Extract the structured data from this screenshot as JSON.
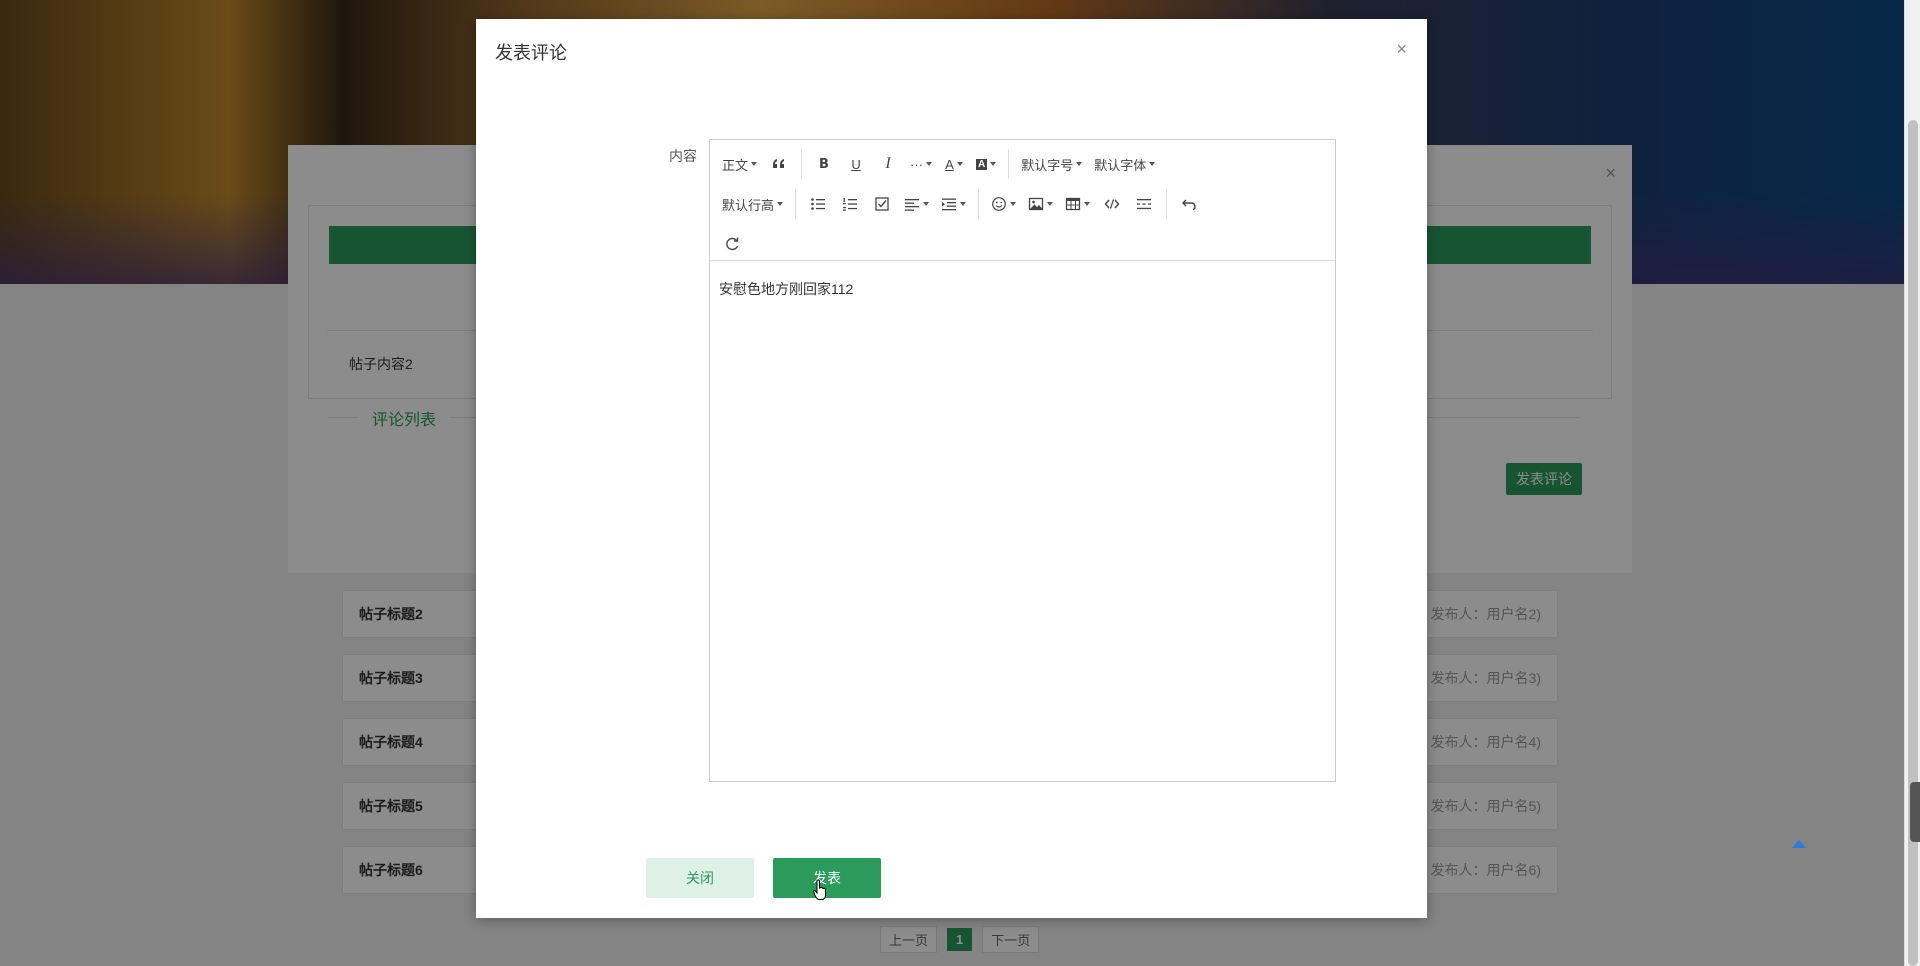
{
  "background": {
    "post_content": "帖子内容2",
    "comment_list_label": "评论列表",
    "post_comment_button": "发表评论",
    "posts": [
      {
        "title": "帖子标题2",
        "author": "发布人：用户名2)"
      },
      {
        "title": "帖子标题3",
        "author": "发布人：用户名3)"
      },
      {
        "title": "帖子标题4",
        "author": "发布人：用户名4)"
      },
      {
        "title": "帖子标题5",
        "author": "发布人：用户名5)"
      },
      {
        "title": "帖子标题6",
        "author": "发布人：用户名6)"
      }
    ],
    "pager": {
      "prev": "上一页",
      "current": "1",
      "next": "下一页"
    }
  },
  "dialog": {
    "title": "发表评论",
    "close_symbol": "×",
    "content_label": "内容",
    "toolbar": {
      "paragraph": "正文",
      "more": "···",
      "font_size": "默认字号",
      "font_family": "默认字体",
      "line_height": "默认行高"
    },
    "editor_text": "安慰色地方刚回家112",
    "close_button": "关闭",
    "submit_button": "发表"
  },
  "colors": {
    "accent": "#2b9b5c",
    "accent_light": "#dff1e6"
  }
}
